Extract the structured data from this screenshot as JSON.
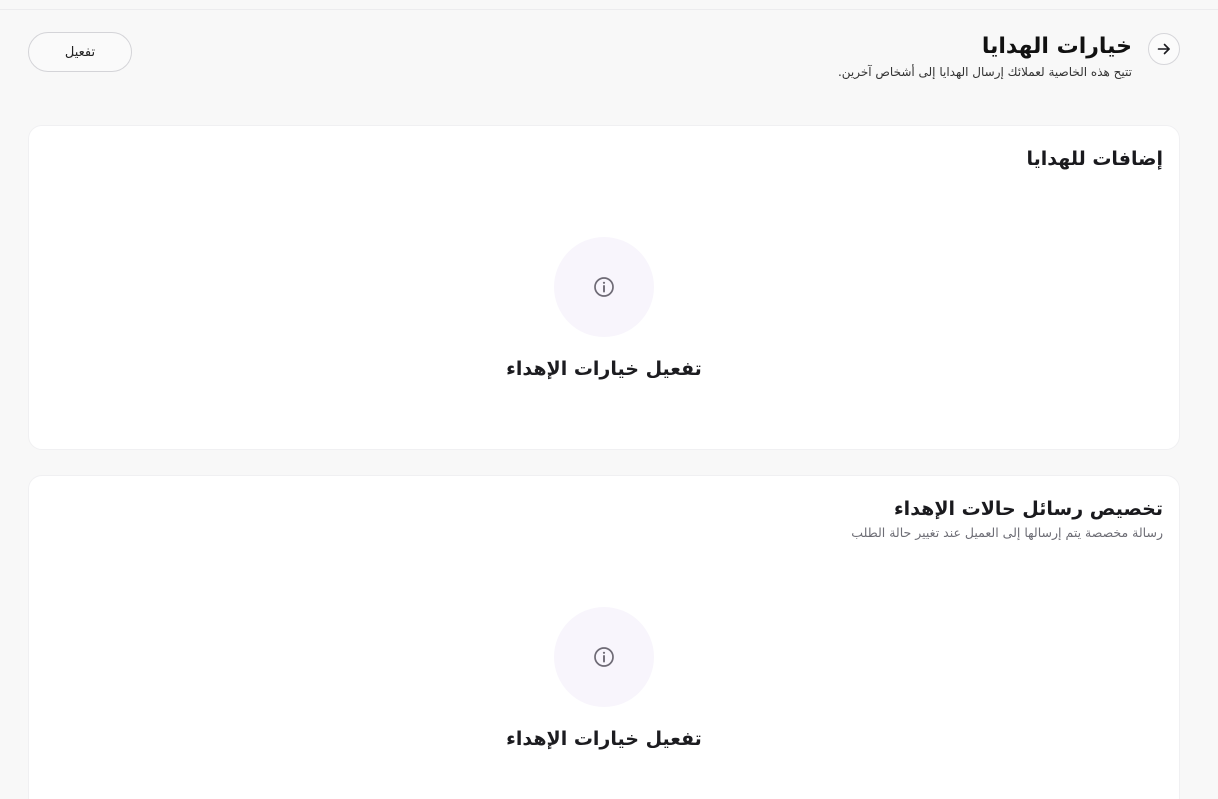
{
  "header": {
    "title": "خيارات الهدايا",
    "subtitle": "تتيح هذه الخاصية لعملائك إرسال الهدايا إلى أشخاص آخرين.",
    "activate_label": "تفعيل",
    "back_icon": "arrow-right-icon"
  },
  "cards": [
    {
      "title": "إضافات للهدايا",
      "empty_icon": "info-icon",
      "empty_label": "تفعيل خيارات الإهداء"
    },
    {
      "title": "تخصيص رسائل حالات الإهداء",
      "description": "رسالة مخصصة يتم إرسالها إلى العميل عند تغيير حالة الطلب",
      "empty_icon": "info-icon",
      "empty_label": "تفعيل خيارات الإهداء"
    }
  ],
  "colors": {
    "background": "#f8f8f8",
    "card": "#ffffff",
    "icon_circle": "#f8f5fc",
    "icon_stroke": "#6e6a75"
  }
}
